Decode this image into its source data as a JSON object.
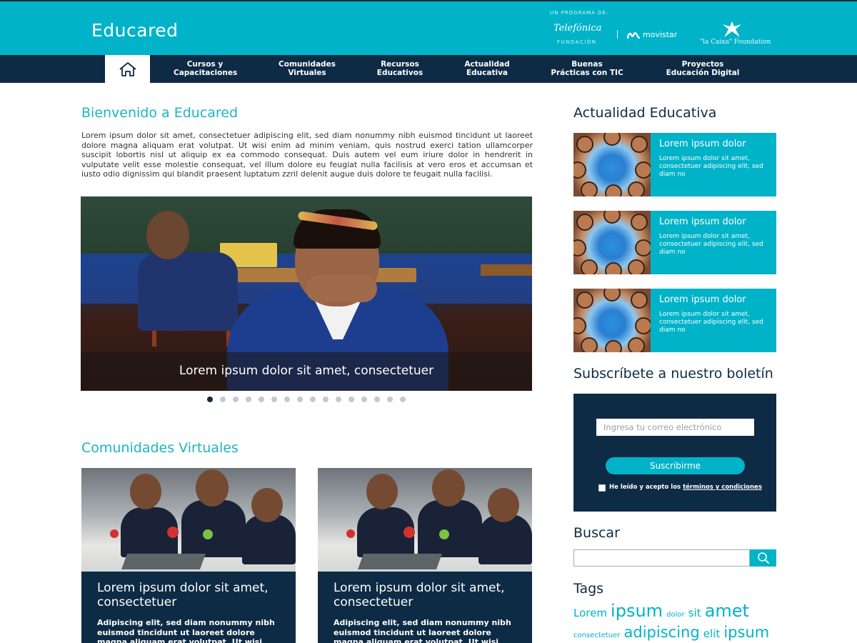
{
  "header": {
    "logo": "Educared",
    "sponsor_caption": "UN PROGRAMA DE:",
    "sponsor_telefonica": "Telefónica",
    "sponsor_fundacion": "FUNDACIÓN",
    "sponsor_movistar": "movistar",
    "sponsor_lacaixa": "\"la Caixa\" Foundation"
  },
  "nav": {
    "home_icon": "home-icon",
    "items": [
      {
        "line1": "Cursos y",
        "line2": "Capacitaciones"
      },
      {
        "line1": "Comunidades",
        "line2": "Virtuales"
      },
      {
        "line1": "Recursos",
        "line2": "Educativos"
      },
      {
        "line1": "Actualidad",
        "line2": "Educativa"
      },
      {
        "line1": "Buenas",
        "line2": "Prácticas con TIC"
      },
      {
        "line1": "Proyectos",
        "line2": "Educación Digital"
      }
    ]
  },
  "main": {
    "welcome_title": "Bienvenido a Educared",
    "intro": "Lorem ipsum dolor sit amet, consectetuer adipiscing elit, sed diam nonummy nibh euismod tincidunt ut laoreet dolore magna aliquam erat volutpat. Ut wisi enim ad minim veniam, quis nostrud exerci tation ullamcorper suscipit lobortis nisl ut aliquip ex ea commodo consequat. Duis autem vel eum iriure dolor in hendrerit in vulputate velit esse molestie consequat, vel illum dolore eu feugiat nulla facilisis at vero eros et accumsan et iusto odio dignissim qui blandit praesent luptatum zzril delenit augue duis dolore te feugait nulla facilisi.",
    "slider_caption": "Lorem ipsum dolor sit amet, consectetuer",
    "slider_dots": 16,
    "slider_active": 1,
    "communities_title": "Comunidades Virtuales",
    "cards": [
      {
        "title": "Lorem ipsum dolor sit amet, consectetuer",
        "text": "Adipiscing elit, sed diam nonummy nibh euismod tincidunt ut laoreet dolore magna aliquam erat volutpat. Ut wisi"
      },
      {
        "title": "Lorem ipsum dolor sit amet, consectetuer",
        "text": "Adipiscing elit, sed diam nonummy nibh euismod tincidunt ut laoreet dolore magna aliquam erat volutpat. Ut wisi"
      }
    ]
  },
  "sidebar": {
    "news_title": "Actualidad Educativa",
    "news": [
      {
        "title": "Lorem ipsum dolor",
        "text": "Lorem ipsum dolor sit amet, consectetuer adipiscing elit, sed diam no"
      },
      {
        "title": "Lorem ipsum dolor",
        "text": "Lorem ipsum dolor sit amet, consectetuer adipiscing elit, sed diam no"
      },
      {
        "title": "Lorem ipsum dolor",
        "text": "Lorem ipsum dolor sit amet, consectetuer adipiscing elit, sed diam no"
      }
    ],
    "newsletter_title": "Subscríbete a nuestro boletín",
    "newsletter_placeholder": "Ingresa tu correo electrónico",
    "newsletter_button": "Suscribirme",
    "newsletter_terms_prefix": "He leído y acepto los ",
    "newsletter_terms_link": "términos y condiciones",
    "search_title": "Buscar",
    "search_icon": "search-icon",
    "tags_title": "Tags",
    "tags": [
      {
        "text": "Lorem",
        "level": 3
      },
      {
        "text": "ipsum",
        "level": 5
      },
      {
        "text": "dolor",
        "level": 1
      },
      {
        "text": "sit",
        "level": 3
      },
      {
        "text": "amet",
        "level": 5
      },
      {
        "text": "consectetuer",
        "level": 1
      },
      {
        "text": "adipiscing",
        "level": 4
      },
      {
        "text": "elit",
        "level": 3
      },
      {
        "text": "ipsum",
        "level": 4
      }
    ]
  },
  "colors": {
    "teal": "#00b3c8",
    "navy": "#0e2b45"
  }
}
